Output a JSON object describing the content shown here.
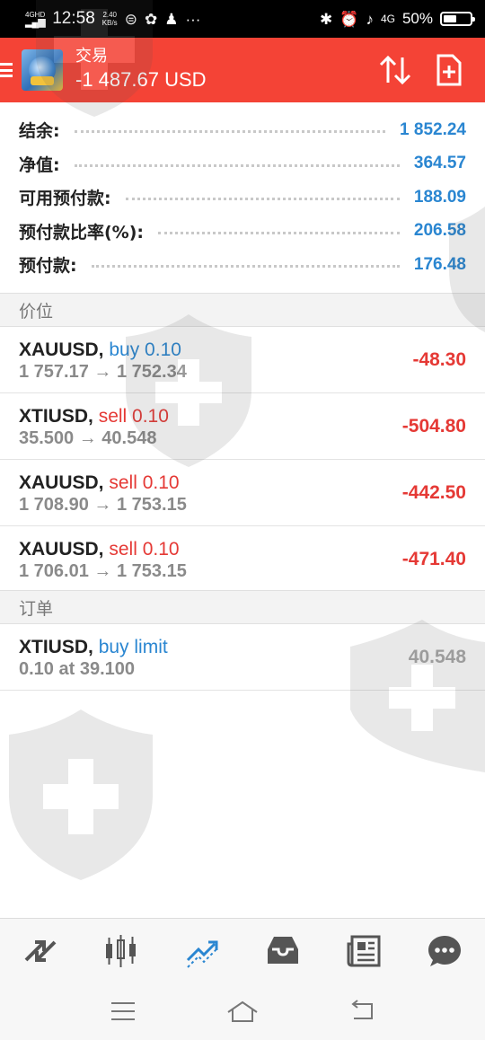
{
  "status_bar": {
    "network": "4GHD",
    "time": "12:58",
    "speed_value": "2.40",
    "speed_unit": "KB/s",
    "battery": "50%"
  },
  "app_bar": {
    "title": "交易",
    "subtitle": "-1 487.67 USD"
  },
  "summary": [
    {
      "label": "结余:",
      "value": "1 852.24"
    },
    {
      "label": "净值:",
      "value": "364.57"
    },
    {
      "label": "可用预付款:",
      "value": "188.09"
    },
    {
      "label": "预付款比率(%):",
      "value": "206.58"
    },
    {
      "label": "预付款:",
      "value": "176.48"
    }
  ],
  "sections": {
    "positions": "价位",
    "orders": "订单"
  },
  "positions": [
    {
      "symbol": "XAUUSD,",
      "type": "buy 0.10",
      "prices": "1 757.17 → 1 752.34",
      "profit": "-48.30"
    },
    {
      "symbol": "XTIUSD,",
      "type": "sell 0.10",
      "prices": "35.500 → 40.548",
      "profit": "-504.80"
    },
    {
      "symbol": "XAUUSD,",
      "type": "sell 0.10",
      "prices": "1 708.90 → 1 753.15",
      "profit": "-442.50"
    },
    {
      "symbol": "XAUUSD,",
      "type": "sell 0.10",
      "prices": "1 706.01 → 1 753.15",
      "profit": "-471.40"
    }
  ],
  "orders": [
    {
      "symbol": "XTIUSD,",
      "type": "buy limit",
      "detail": "0.10 at 39.100",
      "price": "40.548"
    }
  ],
  "colors": {
    "accent": "#f44336",
    "blue": "#2a86d1",
    "loss": "#e53935",
    "active_nav": "#2a86d1"
  },
  "bottom_nav": [
    "quotes-icon",
    "chart-icon",
    "trade-icon",
    "history-icon",
    "news-icon",
    "chat-icon"
  ],
  "system_nav": [
    "menu-icon",
    "home-icon",
    "back-icon"
  ]
}
